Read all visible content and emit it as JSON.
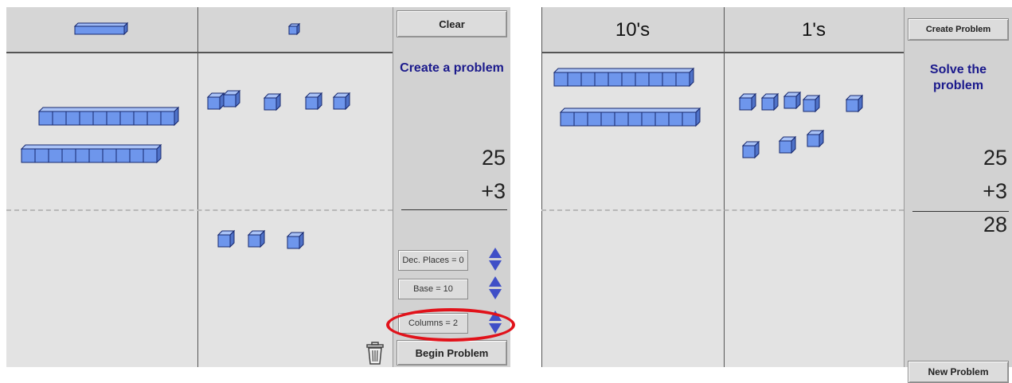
{
  "left": {
    "header_icons": [
      "rod-icon",
      "unit-cube-icon"
    ],
    "clear_label": "Clear",
    "status": "Create a problem",
    "addend1": "25",
    "addend2": "+3",
    "settings": [
      {
        "label": "Dec. Places = 0"
      },
      {
        "label": "Base = 10"
      },
      {
        "label": "Columns = 2"
      }
    ],
    "begin_label": "Begin Problem",
    "trash_icon": "trash-icon"
  },
  "right": {
    "col1_header": "10's",
    "col2_header": "1's",
    "create_label": "Create Problem",
    "status": "Solve the problem",
    "addend1": "25",
    "addend2": "+3",
    "result": "28",
    "new_label": "New Problem"
  },
  "colors": {
    "block_fill": "#6e96ec",
    "block_edge": "#17286e",
    "status_text": "#1b1a8c",
    "highlight": "#e1121a"
  }
}
